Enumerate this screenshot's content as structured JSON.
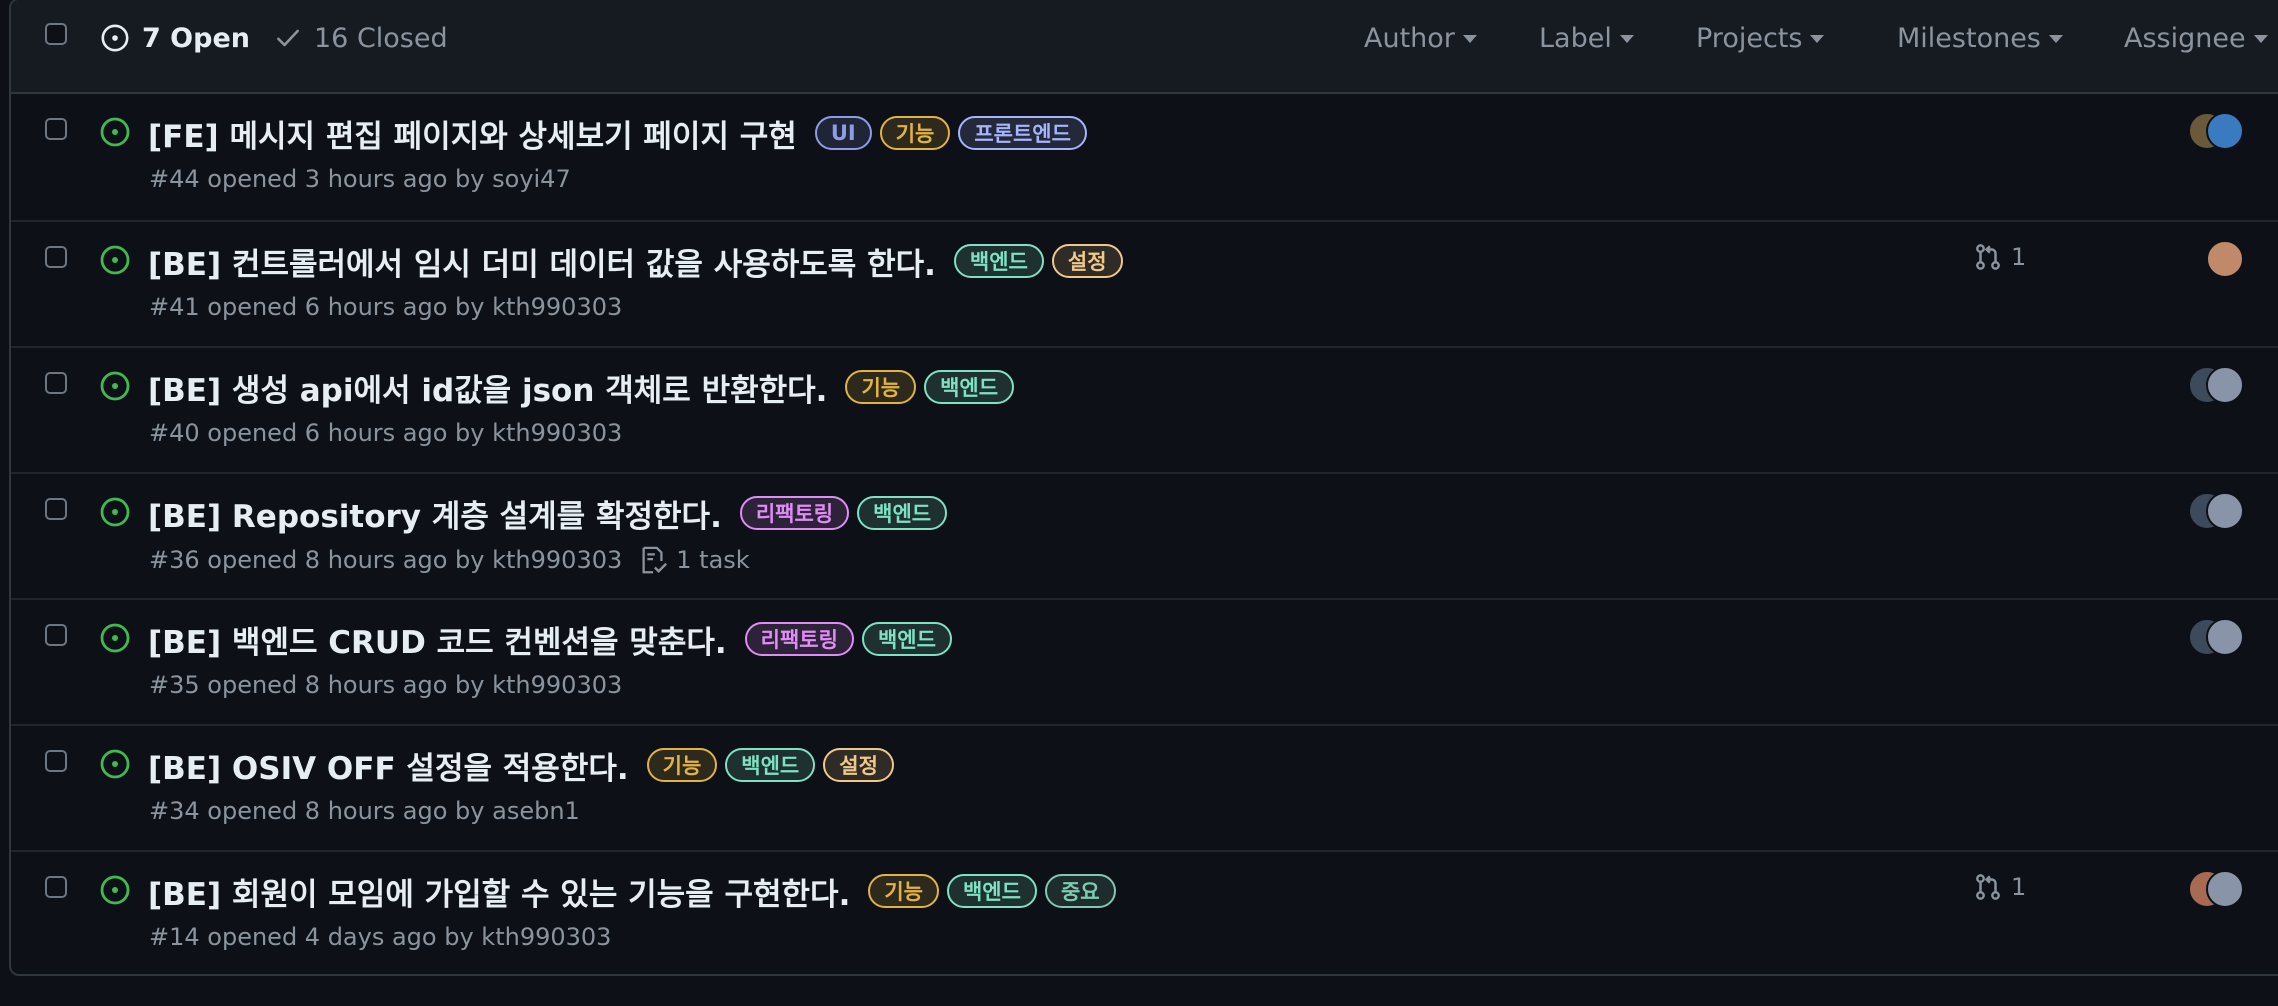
{
  "header": {
    "open_label": "7 Open",
    "closed_label": "16 Closed",
    "filters": [
      "Author",
      "Label",
      "Projects",
      "Milestones",
      "Assignee"
    ]
  },
  "colors": {
    "open_icon": "#3fb950",
    "label_ui": "#8e9ce8",
    "label_feature": "#e3b341",
    "label_frontend": "#a5b4fc",
    "label_backend": "#7ee2c2",
    "label_config": "#f0c98a",
    "label_refactor": "#e08cf5",
    "label_important": "#7fc9b0"
  },
  "issues": [
    {
      "title": "[FE] 메시지 편집 페이지와 상세보기 페이지 구현",
      "labels": [
        {
          "text": "UI",
          "color": "#8e9ce8"
        },
        {
          "text": "기능",
          "color": "#e3b341"
        },
        {
          "text": "프론트엔드",
          "color": "#a5b4fc"
        }
      ],
      "meta": "#44 opened 3 hours ago by soyi47",
      "task": "",
      "pr_count": "",
      "avatar_colors": [
        "#6b5a3a",
        "#3a7bbf"
      ]
    },
    {
      "title": "[BE] 컨트롤러에서 임시 더미 데이터 값을 사용하도록 한다.",
      "labels": [
        {
          "text": "백엔드",
          "color": "#7ee2c2"
        },
        {
          "text": "설정",
          "color": "#f0c98a"
        }
      ],
      "meta": "#41 opened 6 hours ago by kth990303",
      "task": "",
      "pr_count": "1",
      "avatar_colors": [
        "#c08a6a"
      ]
    },
    {
      "title": "[BE] 생성 api에서 id값을 json 객체로 반환한다.",
      "labels": [
        {
          "text": "기능",
          "color": "#e3b341"
        },
        {
          "text": "백엔드",
          "color": "#7ee2c2"
        }
      ],
      "meta": "#40 opened 6 hours ago by kth990303",
      "task": "",
      "pr_count": "",
      "avatar_colors": [
        "#3d4a5c",
        "#8a94a8"
      ]
    },
    {
      "title": "[BE] Repository 계층 설계를 확정한다.",
      "labels": [
        {
          "text": "리팩토링",
          "color": "#e08cf5"
        },
        {
          "text": "백엔드",
          "color": "#7ee2c2"
        }
      ],
      "meta": "#36 opened 8 hours ago by kth990303",
      "task": "1 task",
      "pr_count": "",
      "avatar_colors": [
        "#3d4a5c",
        "#8a94a8"
      ]
    },
    {
      "title": "[BE] 백엔드 CRUD 코드 컨벤션을 맞춘다.",
      "labels": [
        {
          "text": "리팩토링",
          "color": "#e08cf5"
        },
        {
          "text": "백엔드",
          "color": "#7ee2c2"
        }
      ],
      "meta": "#35 opened 8 hours ago by kth990303",
      "task": "",
      "pr_count": "",
      "avatar_colors": [
        "#3d4a5c",
        "#8a94a8"
      ]
    },
    {
      "title": "[BE] OSIV OFF 설정을 적용한다.",
      "labels": [
        {
          "text": "기능",
          "color": "#e3b341"
        },
        {
          "text": "백엔드",
          "color": "#7ee2c2"
        },
        {
          "text": "설정",
          "color": "#f0c98a"
        }
      ],
      "meta": "#34 opened 8 hours ago by asebn1",
      "task": "",
      "pr_count": "",
      "avatar_colors": []
    },
    {
      "title": "[BE] 회원이 모임에 가입할 수 있는 기능을 구현한다.",
      "labels": [
        {
          "text": "기능",
          "color": "#e3b341"
        },
        {
          "text": "백엔드",
          "color": "#7ee2c2"
        },
        {
          "text": "중요",
          "color": "#7fc9b0"
        }
      ],
      "meta": "#14 opened 4 days ago by kth990303",
      "task": "",
      "pr_count": "1",
      "avatar_colors": [
        "#a86a52",
        "#8a94a8"
      ]
    }
  ]
}
